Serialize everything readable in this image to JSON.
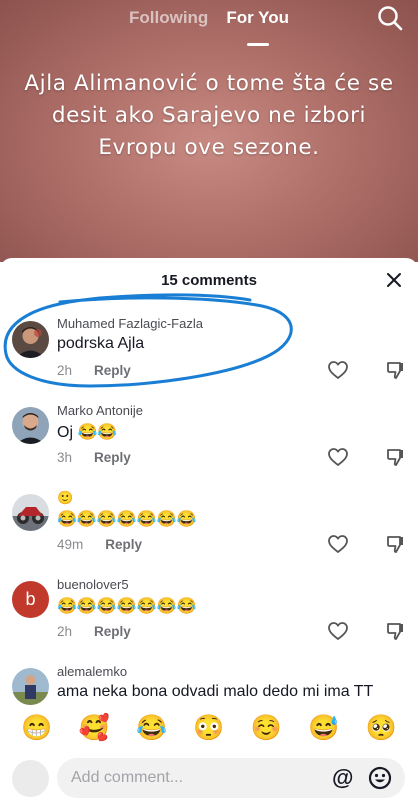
{
  "top_nav": {
    "tabs": [
      {
        "label": "Following",
        "active": false
      },
      {
        "label": "For You",
        "active": true
      }
    ]
  },
  "video": {
    "overlay_text": "Ajla Alimanović o tome šta će se desit ako Sarajevo ne izbori Evropu ove sezone."
  },
  "comments_sheet": {
    "title": "15 comments",
    "reply_label": "Reply",
    "comments": [
      {
        "username": "Muhamed Fazlagic-Fazla",
        "text": "podrska Ajla",
        "time": "2h"
      },
      {
        "username": "Marko Antonije",
        "text": "Oj 😂😂",
        "time": "3h"
      },
      {
        "username": "🙂",
        "text": "😂😂😂😂😂😂😂",
        "time": "49m"
      },
      {
        "username": "buenolover5",
        "text": "😂😂😂😂😂😂😂",
        "time": "2h",
        "avatar_letter": "b"
      },
      {
        "username": "alemalemko",
        "text": "ama neka bona odvadi malo dedo mi ima TT",
        "time": ""
      }
    ]
  },
  "emoji_bar": [
    "😁",
    "🥰",
    "😂",
    "😳",
    "☺️",
    "😅",
    "🥺"
  ],
  "comment_input": {
    "placeholder": "Add comment...",
    "at_symbol": "@"
  },
  "colors": {
    "highlight_circle": "#1a7fd4",
    "reply_text": "#6e6f75",
    "avatar_red": "#c0392b"
  }
}
